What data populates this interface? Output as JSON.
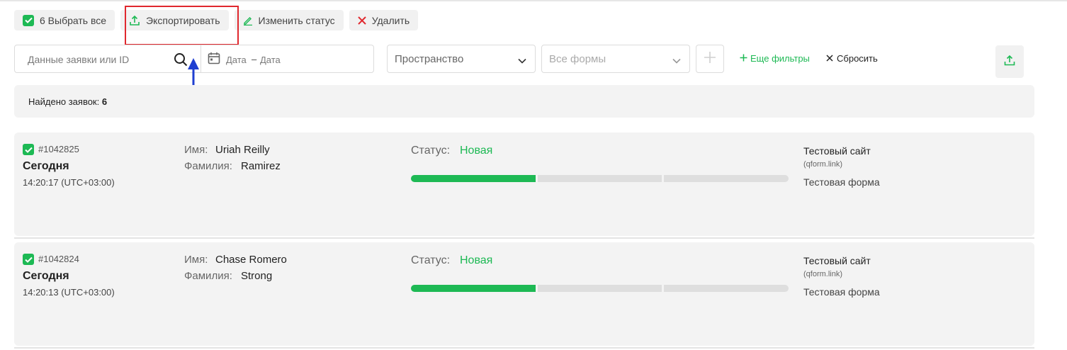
{
  "toolbar": {
    "select_all": "6 Выбрать все",
    "export": "Экспортировать",
    "change_status": "Изменить статус",
    "delete": "Удалить"
  },
  "filters": {
    "search_placeholder": "Данные заявки или ID",
    "date_from": "Дата",
    "date_dash": "–",
    "date_to": "Дата",
    "space_select": "Пространство",
    "forms_select": "Все формы",
    "more_filters": "Еще фильтры",
    "reset": "Сбросить"
  },
  "found": {
    "label": "Найдено заявок:",
    "count": "6"
  },
  "fields": {
    "name_label": "Имя:",
    "surname_label": "Фамилия:",
    "status_label": "Статус:"
  },
  "cards": [
    {
      "id": "#1042825",
      "day": "Сегодня",
      "time": "14:20:17 (UTC+03:00)",
      "name": "Uriah Reilly",
      "surname": "Ramirez",
      "status": "Новая",
      "progress_steps_done": 1,
      "progress_steps_total": 3,
      "site": "Тестовый сайт",
      "domain": "(qform.link)",
      "form": "Тестовая форма"
    },
    {
      "id": "#1042824",
      "day": "Сегодня",
      "time": "14:20:13 (UTC+03:00)",
      "name": "Chase Romero",
      "surname": "Strong",
      "status": "Новая",
      "progress_steps_done": 1,
      "progress_steps_total": 3,
      "site": "Тестовый сайт",
      "domain": "(qform.link)",
      "form": "Тестовая форма"
    }
  ],
  "colors": {
    "accent": "#1db954",
    "delete": "#e0282e",
    "highlight": "#e0282e",
    "arrow": "#1f3fd1"
  },
  "icons": {
    "checkbox": "check-icon",
    "export": "upload-icon",
    "change_status": "pencil-icon",
    "delete": "close-icon",
    "search": "search-icon",
    "date": "calendar-icon",
    "select": "chevron-down-icon",
    "add": "plus-icon",
    "reset": "close-icon"
  }
}
